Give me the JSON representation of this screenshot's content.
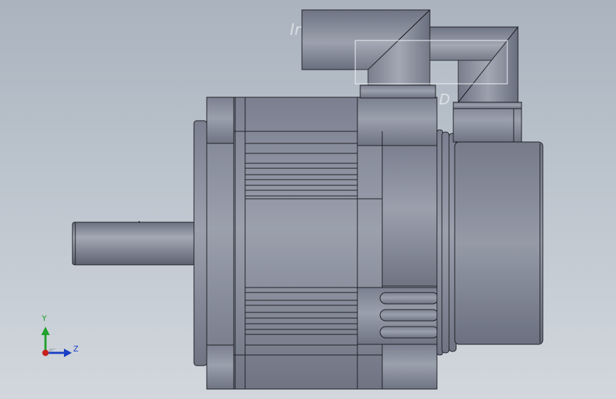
{
  "viewport": {
    "background_top": "#aab3be",
    "background_bottom": "#d2d7dd",
    "model_color": "#8e939f",
    "edge_color": "#1d1f24"
  },
  "ghost_labels": {
    "left": "Ir",
    "right": "D"
  },
  "triad": {
    "y_label": "Y",
    "z_label": "Z",
    "y_color": "#1fa12b",
    "z_color": "#1b3fc4",
    "origin_color": "#c8201c"
  },
  "icons": {
    "triad": "coordinate-triad-icon"
  }
}
